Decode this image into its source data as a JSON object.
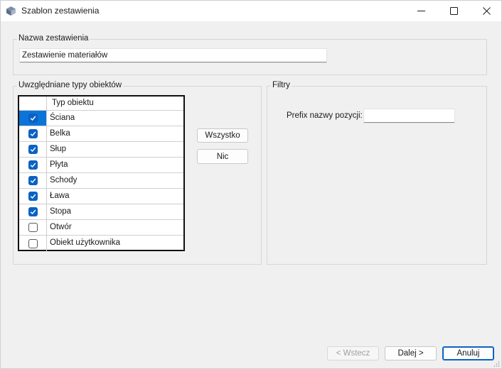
{
  "window": {
    "title": "Szablon zestawienia",
    "icon": "app-cube-icon",
    "controls": [
      "minimize-icon",
      "maximize-icon",
      "close-icon"
    ]
  },
  "name_group": {
    "label": "Nazwa zestawienia",
    "value": "Zestawienie materiałów"
  },
  "types_group": {
    "label": "Uwzględniane typy obiektów",
    "column_header": "Typ obiektu",
    "rows": [
      {
        "label": "Ściana",
        "checked": true,
        "selected": true
      },
      {
        "label": "Belka",
        "checked": true,
        "selected": false
      },
      {
        "label": "Słup",
        "checked": true,
        "selected": false
      },
      {
        "label": "Płyta",
        "checked": true,
        "selected": false
      },
      {
        "label": "Schody",
        "checked": true,
        "selected": false
      },
      {
        "label": "Ława",
        "checked": true,
        "selected": false
      },
      {
        "label": "Stopa",
        "checked": true,
        "selected": false
      },
      {
        "label": "Otwór",
        "checked": false,
        "selected": false
      },
      {
        "label": "Obiekt użytkownika",
        "checked": false,
        "selected": false
      }
    ],
    "all_button": "Wszystko",
    "none_button": "Nic"
  },
  "filters_group": {
    "label": "Filtry",
    "prefix_label": "Prefix nazwy pozycji:",
    "prefix_value": ""
  },
  "footer": {
    "back_button": "< Wstecz",
    "next_button": "Dalej >",
    "cancel_button": "Anuluj"
  },
  "colors": {
    "accent": "#0a62c4",
    "selection": "#0a74d9",
    "window_bg": "#f0f0f0"
  }
}
